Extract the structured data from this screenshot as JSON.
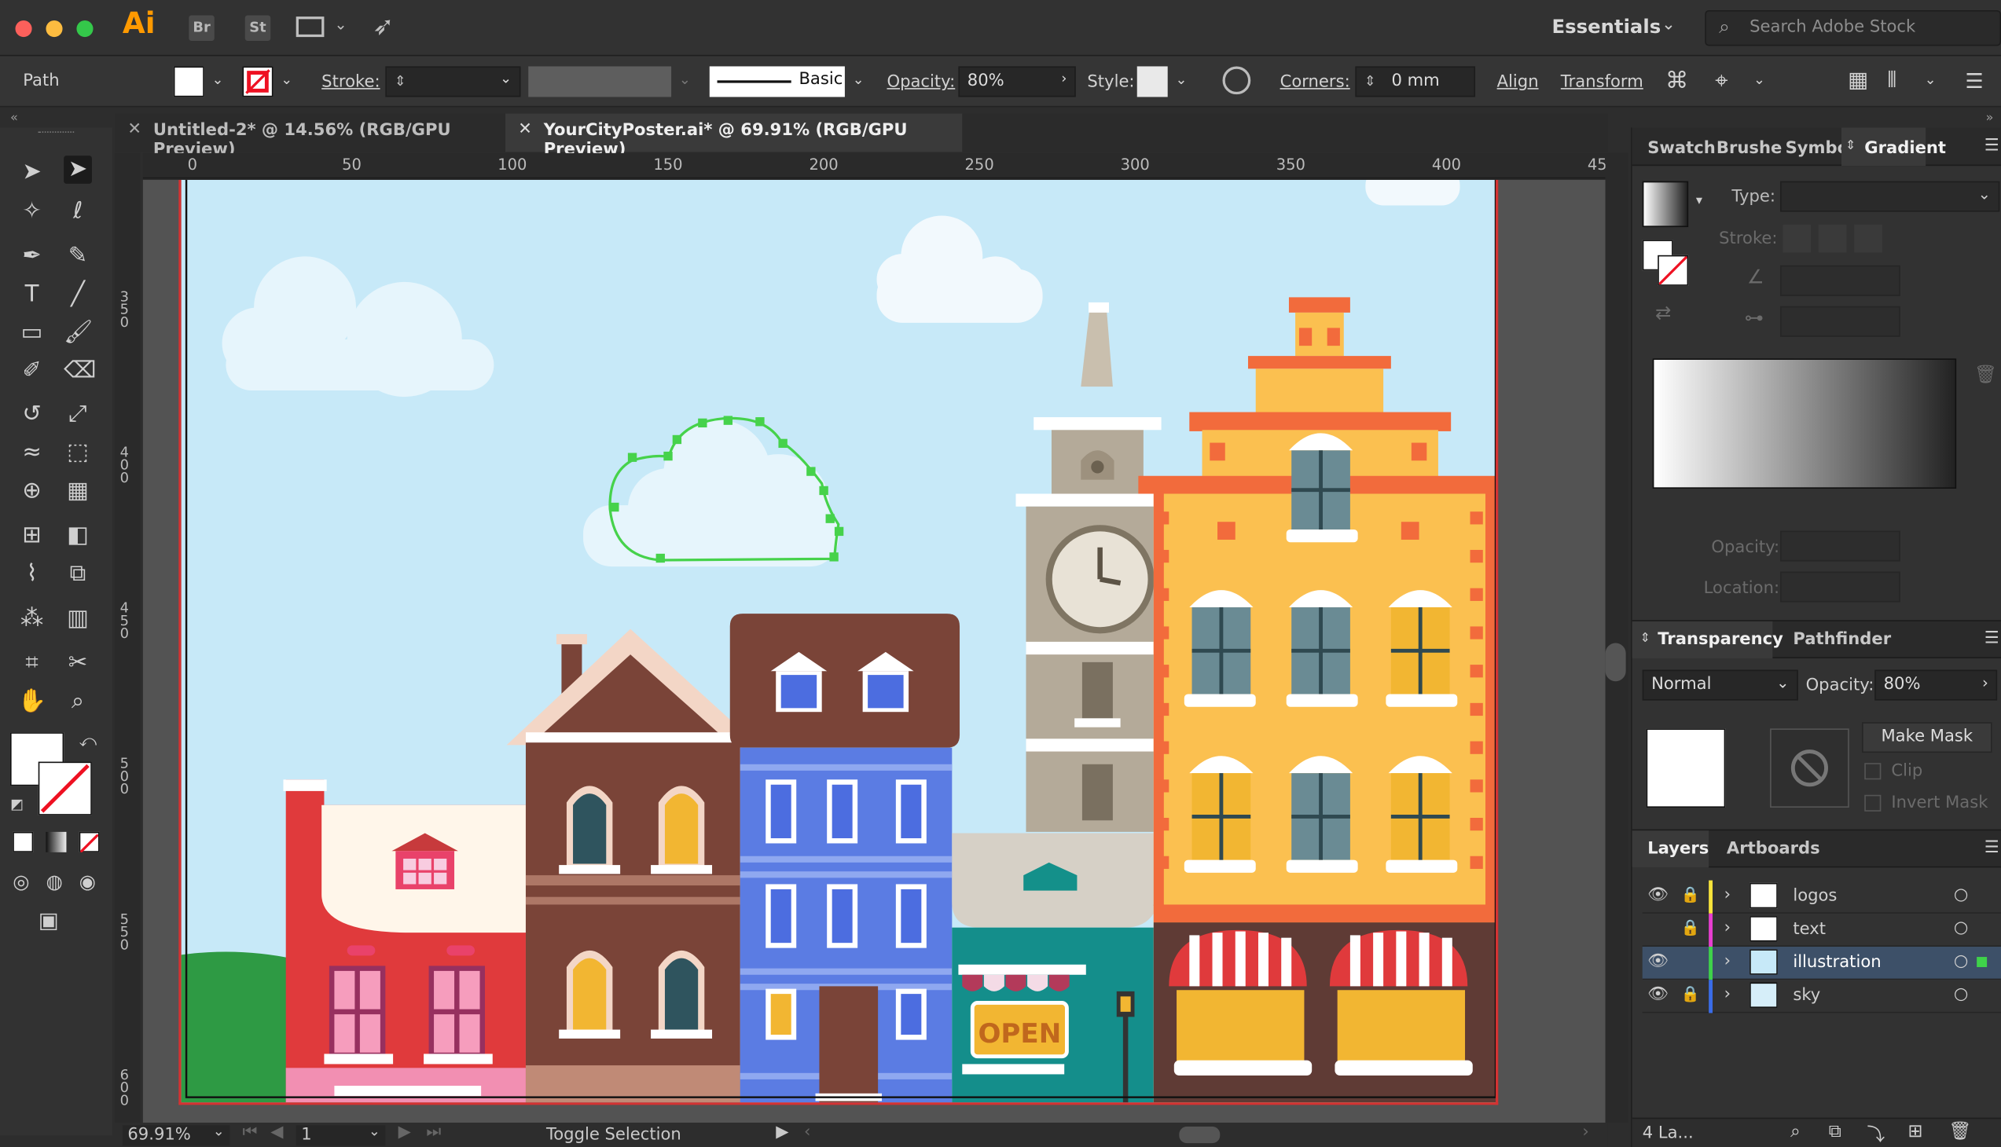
{
  "app": {
    "logo": "Ai",
    "bridge_label": "Br",
    "stock_label": "St",
    "workspace": "Essentials",
    "search_placeholder": "Search Adobe Stock"
  },
  "control_bar": {
    "selection_type": "Path",
    "stroke_label": "Stroke:",
    "brush_label": "Basic",
    "opacity_label": "Opacity:",
    "opacity_value": "80%",
    "style_label": "Style:",
    "corners_label": "Corners:",
    "corners_value": "0 mm",
    "align_label": "Align",
    "transform_label": "Transform"
  },
  "documents": [
    {
      "title": "Untitled-2* @ 14.56% (RGB/GPU Preview)",
      "active": false
    },
    {
      "title": "YourCityPoster.ai* @ 69.91% (RGB/GPU Preview)",
      "active": true
    }
  ],
  "rulers": {
    "h_ticks": [
      "0",
      "50",
      "100",
      "150",
      "200",
      "250",
      "300",
      "350",
      "400",
      "45"
    ],
    "v_ticks": [
      "3\n5\n0",
      "4\n0\n0",
      "4\n5\n0",
      "5\n0\n0",
      "5\n5\n0",
      "6\n0\n0"
    ]
  },
  "canvas_text": {
    "open_sign": "OPEN"
  },
  "status_bar": {
    "zoom": "69.91%",
    "artboard_number": "1",
    "tool_hint": "Toggle Selection"
  },
  "panels": {
    "top_tabs": [
      "Swatch",
      "Brushe",
      "Symbo",
      "Gradient"
    ],
    "gradient": {
      "type_label": "Type:",
      "stroke_label": "Stroke:",
      "opacity_label": "Opacity:",
      "location_label": "Location:"
    },
    "transparency": {
      "tab_label": "Transparency",
      "pathfinder_label": "Pathfinder",
      "blend_mode": "Normal",
      "opacity_label": "Opacity:",
      "opacity_value": "80%",
      "make_mask": "Make Mask",
      "clip": "Clip",
      "invert_mask": "Invert Mask"
    },
    "layers": {
      "tab_label": "Layers",
      "artboards_label": "Artboards",
      "count_label": "4 La...",
      "items": [
        {
          "name": "logos",
          "color": "#f7e33b",
          "visible": true,
          "locked": true
        },
        {
          "name": "text",
          "color": "#e83ed0",
          "visible": false,
          "locked": true
        },
        {
          "name": "illustration",
          "color": "#3fd24a",
          "visible": true,
          "locked": false
        },
        {
          "name": "sky",
          "color": "#3a6ce8",
          "visible": true,
          "locked": true
        }
      ]
    }
  }
}
